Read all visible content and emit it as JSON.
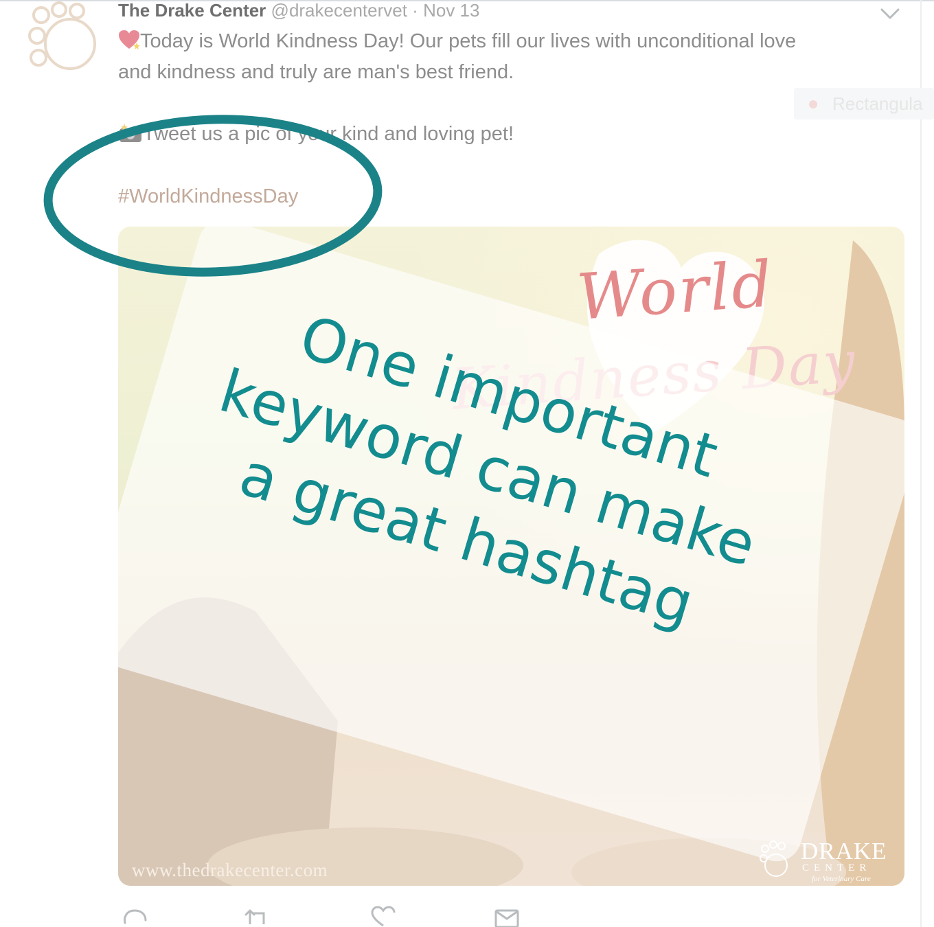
{
  "tweet": {
    "author_name": "The Drake Center",
    "author_handle": "@drakecentervet",
    "separator": "·",
    "date": "Nov 13",
    "line1": "Today is World Kindness Day! Our pets fill our lives with unconditional love",
    "line2": "and kindness and truly are man's best friend.",
    "line3": "Tweet us a pic of your kind and loving pet!",
    "hashtag": "#WorldKindnessDay"
  },
  "ghost_chip": {
    "label": "Rectangula"
  },
  "media": {
    "title_world": "World",
    "title_kindness": "Kindness Day",
    "url": "www.thedrakecenter.com",
    "brand_name": "DRAKE",
    "brand_sub": "CENTER",
    "brand_tagline": "for Veterinary Care"
  },
  "overlay": {
    "lines": [
      "One important",
      "keyword can make",
      "a great hashtag"
    ]
  },
  "icons": {
    "avatar": "paw-print-logo",
    "caret": "chevron-down-icon",
    "emoji1": "heart-sparkle-emoji",
    "emoji2": "camera-emoji",
    "reply": "reply-icon",
    "retweet": "retweet-icon",
    "like": "heart-icon",
    "dm": "envelope-icon"
  },
  "colors": {
    "overlay_text": "#138c8f",
    "annotation_ring": "#1b8388",
    "hashtag": "#c3a99a",
    "title_world": "#e58a8a"
  }
}
